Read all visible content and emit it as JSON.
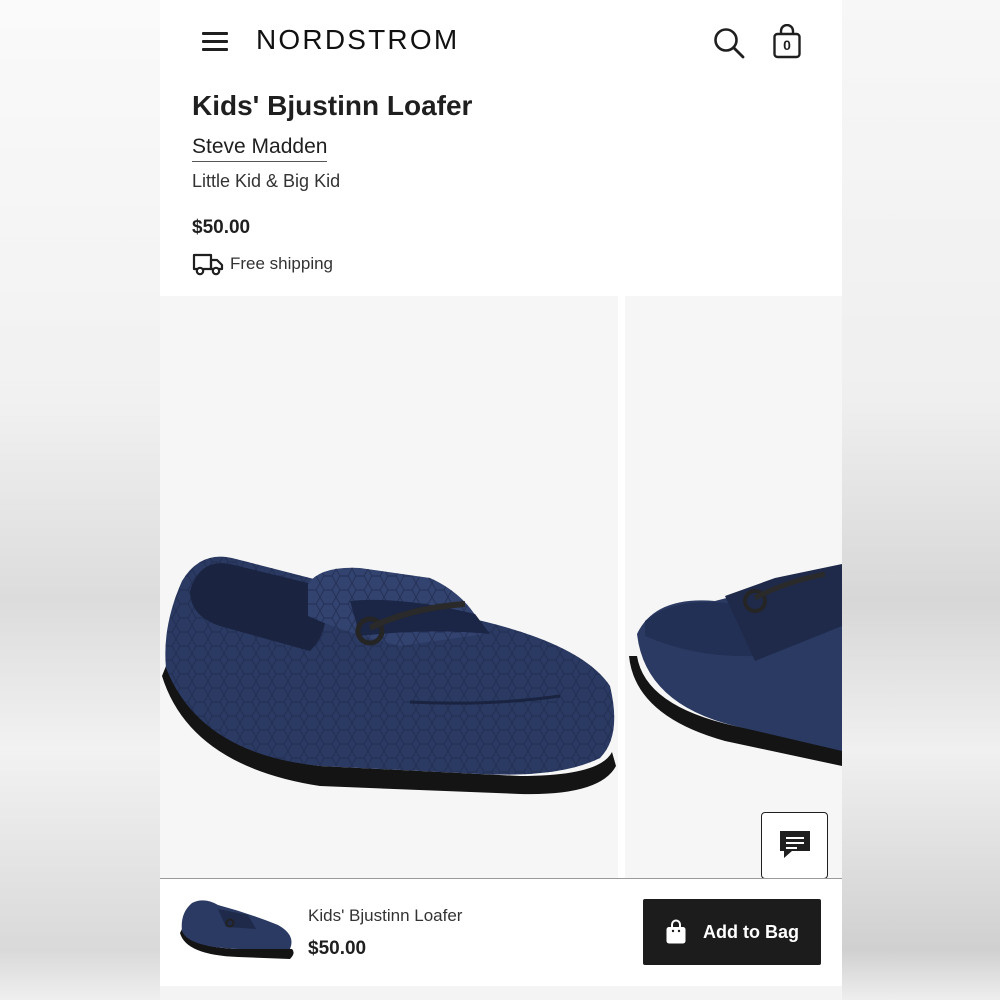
{
  "header": {
    "logo": "NORDSTROM",
    "bag_count": "0",
    "icons": [
      "menu-icon",
      "search-icon",
      "shopping-bag-icon"
    ]
  },
  "product": {
    "title": "Kids' Bjustinn Loafer",
    "brand": "Steve Madden",
    "subtitle": "Little Kid & Big Kid",
    "price": "$50.00",
    "shipping": "Free shipping"
  },
  "sticky_bar": {
    "title": "Kids' Bjustinn Loafer",
    "price": "$50.00",
    "add_to_bag_label": "Add to Bag"
  },
  "colors": {
    "shoe_navy": "#2b3a63",
    "sole": "#141414",
    "button_bg": "#1c1c1c",
    "page_bg": "#ffffff",
    "photo_bg": "#f6f6f6"
  }
}
